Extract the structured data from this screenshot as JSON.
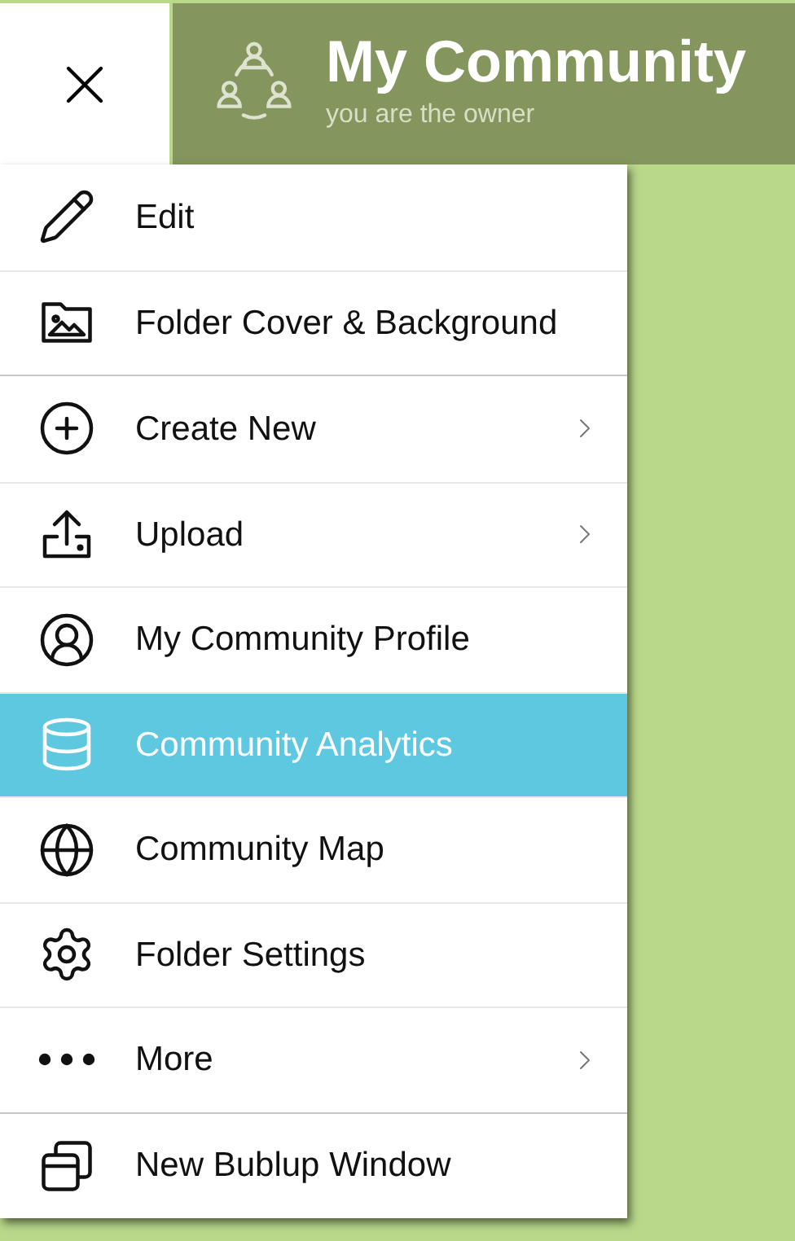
{
  "header": {
    "title": "My Community",
    "subtitle": "you are the owner"
  },
  "menu": {
    "groups": [
      [
        {
          "label": "Edit",
          "submenu": false,
          "selected": false
        },
        {
          "label": "Folder Cover & Background",
          "submenu": false,
          "selected": false
        }
      ],
      [
        {
          "label": "Create New",
          "submenu": true,
          "selected": false
        },
        {
          "label": "Upload",
          "submenu": true,
          "selected": false
        },
        {
          "label": "My Community Profile",
          "submenu": false,
          "selected": false
        },
        {
          "label": "Community Analytics",
          "submenu": false,
          "selected": true
        },
        {
          "label": "Community Map",
          "submenu": false,
          "selected": false
        },
        {
          "label": "Folder Settings",
          "submenu": false,
          "selected": false
        },
        {
          "label": "More",
          "submenu": true,
          "selected": false
        }
      ],
      [
        {
          "label": "New Bublup Window",
          "submenu": false,
          "selected": false
        }
      ]
    ]
  }
}
